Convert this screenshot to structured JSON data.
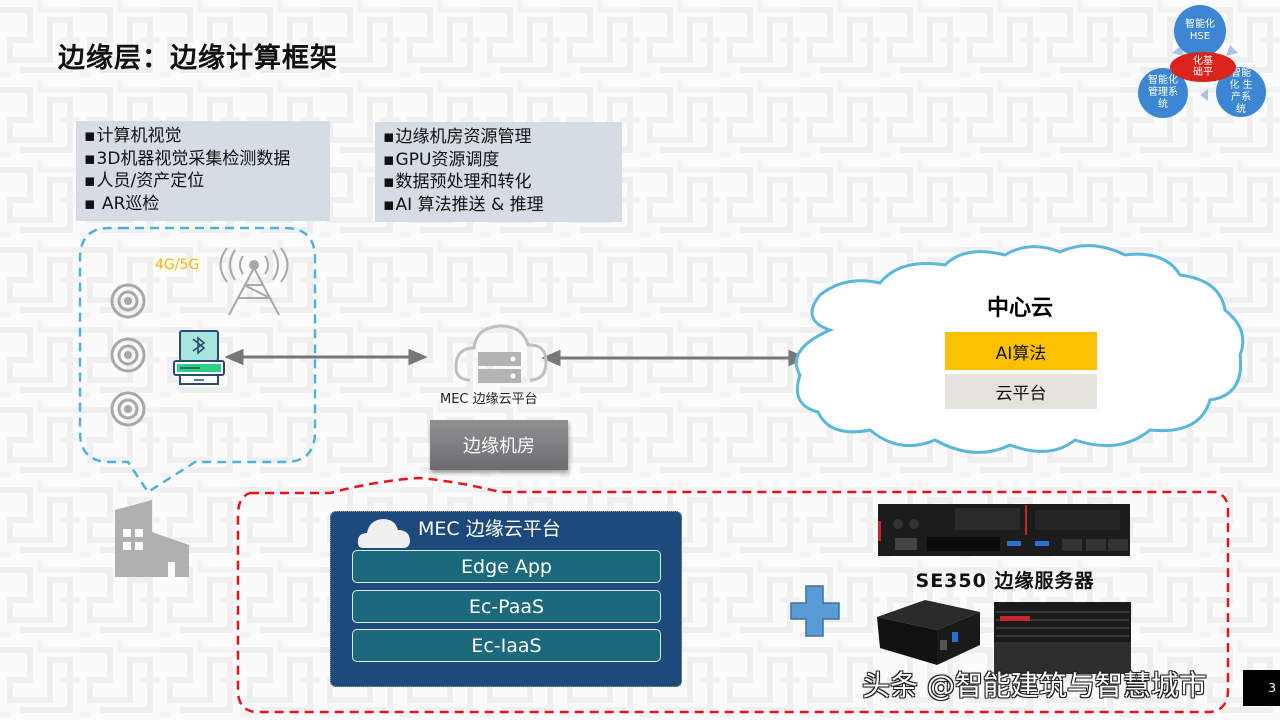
{
  "slide": {
    "title": "边缘层：边缘计算框架",
    "page_number": "3",
    "watermark": "头条 @智能建筑与智慧城市"
  },
  "device_capabilities": {
    "items": [
      "计算机视觉",
      "3D机器视觉采集检测数据",
      "人员/资产定位",
      " AR巡检"
    ]
  },
  "edge_room_capabilities": {
    "items": [
      "边缘机房资源管理",
      "GPU资源调度",
      "数据预处理和转化",
      "AI 算法推送 & 推理"
    ]
  },
  "device_area": {
    "network_label": "4G/5G",
    "icons": [
      "sensor-icon",
      "sensor-icon",
      "sensor-icon",
      "cell-tower-icon",
      "bluetooth-gateway-icon"
    ]
  },
  "mec_node": {
    "label": "MEC 边缘云平台",
    "room_button": "边缘机房"
  },
  "center_cloud": {
    "title": "中心云",
    "ai_label": "AI算法",
    "platform_label": "云平台",
    "ai_color": "#fbc100",
    "platform_color": "#e6e3df"
  },
  "mec_platform": {
    "title": "MEC 边缘云平台",
    "layers": [
      "Edge App",
      "Ec-PaaS",
      "Ec-IaaS"
    ],
    "panel_color": "#1c4a7d",
    "layer_color": "#1a6a7c"
  },
  "edge_server": {
    "label": "SE350 边缘服务器",
    "plus_icon": "plus-icon"
  },
  "logo_diagram": {
    "top": [
      "智能化",
      "HSE"
    ],
    "left": [
      "智能化",
      "管理系",
      "统"
    ],
    "right": [
      "智能",
      "化 生",
      "产系",
      "统"
    ],
    "center": [
      "智能",
      "化基",
      "础平"
    ]
  },
  "colors": {
    "accent_red": "#e8141a",
    "accent_blue_dash": "#4fb3d9",
    "logo_blue": "#3b87d4",
    "logo_red": "#d9241c"
  }
}
